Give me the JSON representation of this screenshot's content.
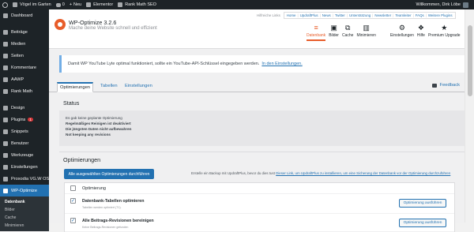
{
  "admin_bar": {
    "site_name": "Vögel im Garten",
    "comments_count": "0",
    "new_label": "Neu",
    "elementor_label": "Elementor",
    "rankmath_label": "Rank Math SEO",
    "greeting": "Willkommen, Dirk Löbe"
  },
  "sidebar": {
    "items": [
      {
        "label": "Dashboard"
      },
      {
        "label": "Beiträge"
      },
      {
        "label": "Medien"
      },
      {
        "label": "Seiten"
      },
      {
        "label": "Kommentare"
      },
      {
        "label": "AAWP"
      },
      {
        "label": "Rank Math"
      },
      {
        "label": "Design"
      },
      {
        "label": "Plugins",
        "badge": "1"
      },
      {
        "label": "Snippets"
      },
      {
        "label": "Benutzer"
      },
      {
        "label": "Werkzeuge"
      },
      {
        "label": "Einstellungen"
      },
      {
        "label": "Proxodia VG.W OS"
      },
      {
        "label": "WP-Optimize"
      }
    ],
    "submenu": [
      "Datenbank",
      "Bilder",
      "Cache",
      "Minimieren"
    ]
  },
  "header": {
    "title": "WP-Optimize 3.2.6",
    "subtitle": "Mache deine Website schnell und effizient",
    "ext_label": "Hilfreiche Links",
    "ext_links": [
      "Home",
      "UpdraftPlus",
      "News",
      "Twitter",
      "Unterstützung",
      "Newsletter",
      "Teamleiter",
      "FAQs",
      "Weitere Plugins"
    ],
    "nav": [
      {
        "label": "Datenbank",
        "glyph": "≡"
      },
      {
        "label": "Bilder",
        "glyph": "▣"
      },
      {
        "label": "Cache",
        "glyph": "⧉"
      },
      {
        "label": "Minimieren",
        "glyph": "▥"
      },
      {
        "label": "Einstellungen",
        "glyph": "⚙"
      },
      {
        "label": "Hilfe",
        "glyph": "❖"
      },
      {
        "label": "Premium Upgrade",
        "glyph": "★"
      }
    ]
  },
  "notice": {
    "text": "Damit WP YouTube Lyte optimal funktioniert, sollte ein YouTube-API-Schlüssel eingegeben werden.",
    "link": "In den Einstellungen."
  },
  "tabs": {
    "items": [
      "Optimierungen",
      "Tabellen",
      "Einstellungen"
    ],
    "feedback": "Feedback"
  },
  "status": {
    "heading": "Status",
    "lines": [
      "Es gab keine geplante Optimierung",
      "Regelmäßiges Reinigen ist deaktiviert",
      "Die jüngsten Daten nicht aufbewahren",
      "Not keeping any revisions"
    ]
  },
  "optimizations": {
    "heading": "Optimierungen",
    "run_all": "Alle ausgewählten Optimierungen durchführen",
    "backup_text": "Erstelle ein Backup mit UpdraftPlus, bevor du dies tust",
    "backup_link": "Dieser Link, um UpdraftPlus zu installieren, um eine Sicherung der Datenbank vor der Optimierung durchzuführen",
    "column_header": "Optimierung",
    "rows": [
      {
        "title": "Datenbank-Tabellen optimieren",
        "sub": "Tabellen werden optimiert (T1).",
        "button": "Optimierung ausführen",
        "checked": true
      },
      {
        "title": "Alle Beitrags-Revisionen bereinigen",
        "sub": "Keine Beitrags-Revisionen gefunden",
        "button": "Optimierung ausführen",
        "checked": true
      }
    ]
  }
}
